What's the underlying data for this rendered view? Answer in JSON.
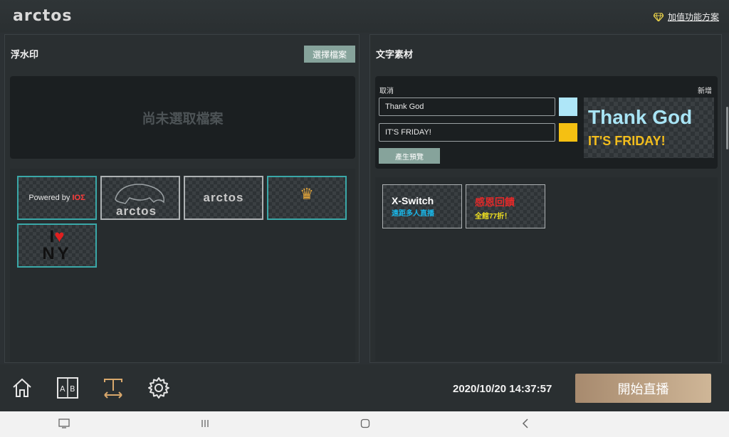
{
  "app": {
    "logo": "arctos"
  },
  "header": {
    "addon_label": "加值功能方案"
  },
  "watermark": {
    "title": "浮水印",
    "select_button": "選擇檔案",
    "empty_text": "尚未選取檔案",
    "thumbnails": [
      {
        "kind": "powered-by",
        "text": "Powered by",
        "brand": "IOΣ"
      },
      {
        "kind": "bear-logo",
        "text": "arctos"
      },
      {
        "kind": "arctos-logo",
        "text": "arctos"
      },
      {
        "kind": "crown-logo",
        "text": "♛"
      },
      {
        "kind": "i-love-ny",
        "top": "I",
        "heart": "♥",
        "bottom": "NY"
      }
    ]
  },
  "text_material": {
    "title": "文字素材",
    "cancel_label": "取消",
    "add_label": "新增",
    "line1_value": "Thank God",
    "line2_value": "IT'S FRIDAY!",
    "line1_color": "#aee6f8",
    "line2_color": "#f5c012",
    "generate_button": "產生預覽",
    "preview_line1": "Thank God",
    "preview_line2": "IT'S FRIDAY!",
    "items": [
      {
        "title": "X-Switch",
        "subtitle": "遠距多人直播",
        "title_color": "#ffffff",
        "subtitle_color": "#19b6e8"
      },
      {
        "title": "感恩回饋",
        "subtitle": "全館77折！",
        "title_color": "#e02a2a",
        "subtitle_color": "#f0e020"
      }
    ]
  },
  "bottom": {
    "datetime": "2020/10/20 14:37:57",
    "start_button": "開始直播"
  }
}
